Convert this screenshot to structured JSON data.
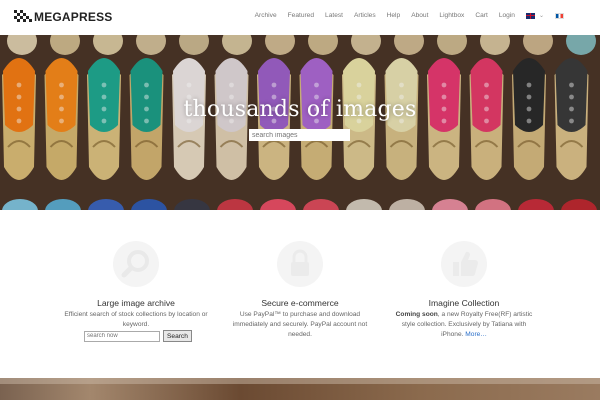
{
  "site": {
    "logo_text": "MEGAPRESS"
  },
  "nav": {
    "items": [
      "Archive",
      "Featured",
      "Latest",
      "Articles",
      "Help",
      "About",
      "Lightbox",
      "Cart",
      "Login"
    ],
    "lang_dropdown_icon": "chevron-down-icon"
  },
  "hero": {
    "title": "thousands of images",
    "search_placeholder": "search images",
    "image_description": "rows of embroidered slippers"
  },
  "features": [
    {
      "title": "Large image archive",
      "text": "Efficient search of stock collections by location or keyword.",
      "icon": "search-icon",
      "search_placeholder": "search now",
      "search_button": "Search"
    },
    {
      "title": "Secure e-commerce",
      "text": "Use PayPal™ to purchase and download immediately and securely. PayPal account not needed.",
      "icon": "lock-icon"
    },
    {
      "title": "Imagine Collection",
      "text_bold": "Coming soon",
      "text": ", a new Royalty Free(RF) artistic style collection.  Exclusively by Tatiana with iPhone.",
      "more_link": "More…",
      "icon": "thumbs-up-icon"
    }
  ],
  "colors": {
    "accent_link": "#2a6fc9",
    "hero_text": "#ffffff",
    "icon_faint": "#f2f2f2"
  }
}
